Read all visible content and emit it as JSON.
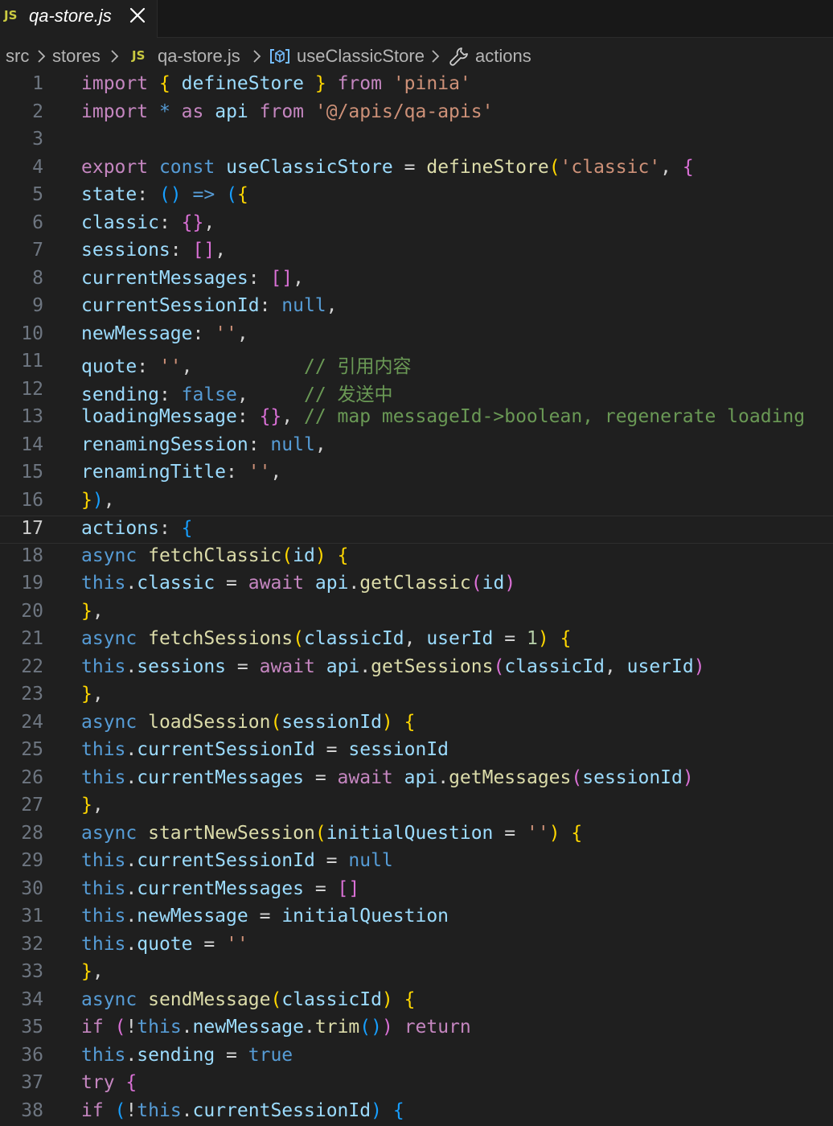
{
  "tab": {
    "badge": "JS",
    "filename": "qa-store.js"
  },
  "breadcrumb": {
    "items": [
      {
        "label": "src"
      },
      {
        "label": "stores"
      },
      {
        "label": "qa-store.js",
        "badge": "JS"
      },
      {
        "label": "useClassicStore"
      },
      {
        "label": "actions"
      }
    ]
  },
  "editor": {
    "current_line": 17,
    "lines": [
      {
        "n": "1",
        "tokens": [
          [
            "ctl",
            "import"
          ],
          [
            "pl",
            " "
          ],
          [
            "b1",
            "{"
          ],
          [
            "pl",
            " "
          ],
          [
            "id",
            "defineStore"
          ],
          [
            "pl",
            " "
          ],
          [
            "b1",
            "}"
          ],
          [
            "pl",
            " "
          ],
          [
            "ctl",
            "from"
          ],
          [
            "pl",
            " "
          ],
          [
            "str",
            "'pinia'"
          ]
        ]
      },
      {
        "n": "2",
        "tokens": [
          [
            "ctl",
            "import"
          ],
          [
            "pl",
            " "
          ],
          [
            "kw",
            "*"
          ],
          [
            "pl",
            " "
          ],
          [
            "ctl",
            "as"
          ],
          [
            "pl",
            " "
          ],
          [
            "id",
            "api"
          ],
          [
            "pl",
            " "
          ],
          [
            "ctl",
            "from"
          ],
          [
            "pl",
            " "
          ],
          [
            "str",
            "'@/apis/qa-apis'"
          ]
        ]
      },
      {
        "n": "3",
        "tokens": []
      },
      {
        "n": "4",
        "tokens": [
          [
            "ctl",
            "export"
          ],
          [
            "pl",
            " "
          ],
          [
            "kw",
            "const"
          ],
          [
            "pl",
            " "
          ],
          [
            "id",
            "useClassicStore"
          ],
          [
            "pl",
            " "
          ],
          [
            "op",
            "="
          ],
          [
            "pl",
            " "
          ],
          [
            "fn",
            "defineStore"
          ],
          [
            "b1",
            "("
          ],
          [
            "str",
            "'classic'"
          ],
          [
            "pl",
            ", "
          ],
          [
            "b2",
            "{"
          ]
        ]
      },
      {
        "n": "5",
        "tokens": [
          [
            "id",
            "state"
          ],
          [
            "pl",
            ": "
          ],
          [
            "b3",
            "()"
          ],
          [
            "pl",
            " "
          ],
          [
            "kw",
            "=>"
          ],
          [
            "pl",
            " "
          ],
          [
            "b3",
            "("
          ],
          [
            "b1",
            "{"
          ]
        ]
      },
      {
        "n": "6",
        "tokens": [
          [
            "id",
            "classic"
          ],
          [
            "pl",
            ": "
          ],
          [
            "b2",
            "{}"
          ],
          [
            "pl",
            ","
          ]
        ]
      },
      {
        "n": "7",
        "tokens": [
          [
            "id",
            "sessions"
          ],
          [
            "pl",
            ": "
          ],
          [
            "b2",
            "[]"
          ],
          [
            "pl",
            ","
          ]
        ]
      },
      {
        "n": "8",
        "tokens": [
          [
            "id",
            "currentMessages"
          ],
          [
            "pl",
            ": "
          ],
          [
            "b2",
            "[]"
          ],
          [
            "pl",
            ","
          ]
        ]
      },
      {
        "n": "9",
        "tokens": [
          [
            "id",
            "currentSessionId"
          ],
          [
            "pl",
            ": "
          ],
          [
            "kw",
            "null"
          ],
          [
            "pl",
            ","
          ]
        ]
      },
      {
        "n": "10",
        "tokens": [
          [
            "id",
            "newMessage"
          ],
          [
            "pl",
            ": "
          ],
          [
            "str",
            "''"
          ],
          [
            "pl",
            ","
          ]
        ]
      },
      {
        "n": "11",
        "tokens": [
          [
            "id",
            "quote"
          ],
          [
            "pl",
            ": "
          ],
          [
            "str",
            "''"
          ],
          [
            "pl",
            ",          "
          ],
          [
            "cmt",
            "// "
          ],
          [
            "cmtcjk",
            "引用内容"
          ]
        ]
      },
      {
        "n": "12",
        "tokens": [
          [
            "id",
            "sending"
          ],
          [
            "pl",
            ": "
          ],
          [
            "kw",
            "false"
          ],
          [
            "pl",
            ",     "
          ],
          [
            "cmt",
            "// "
          ],
          [
            "cmtcjk",
            "发送中"
          ]
        ]
      },
      {
        "n": "13",
        "tokens": [
          [
            "id",
            "loadingMessage"
          ],
          [
            "pl",
            ": "
          ],
          [
            "b2",
            "{}"
          ],
          [
            "pl",
            ", "
          ],
          [
            "cmt",
            "// map messageId->boolean, regenerate loading"
          ]
        ]
      },
      {
        "n": "14",
        "tokens": [
          [
            "id",
            "renamingSession"
          ],
          [
            "pl",
            ": "
          ],
          [
            "kw",
            "null"
          ],
          [
            "pl",
            ","
          ]
        ]
      },
      {
        "n": "15",
        "tokens": [
          [
            "id",
            "renamingTitle"
          ],
          [
            "pl",
            ": "
          ],
          [
            "str",
            "''"
          ],
          [
            "pl",
            ","
          ]
        ]
      },
      {
        "n": "16",
        "tokens": [
          [
            "b1",
            "}"
          ],
          [
            "b3",
            ")"
          ],
          [
            "pl",
            ","
          ]
        ]
      },
      {
        "n": "17",
        "tokens": [
          [
            "id",
            "actions"
          ],
          [
            "pl",
            ": "
          ],
          [
            "b3",
            "{"
          ]
        ]
      },
      {
        "n": "18",
        "tokens": [
          [
            "kw",
            "async"
          ],
          [
            "pl",
            " "
          ],
          [
            "fn",
            "fetchClassic"
          ],
          [
            "b1",
            "("
          ],
          [
            "id",
            "id"
          ],
          [
            "b1",
            ")"
          ],
          [
            "pl",
            " "
          ],
          [
            "b1",
            "{"
          ]
        ]
      },
      {
        "n": "19",
        "tokens": [
          [
            "kw",
            "this"
          ],
          [
            "pl",
            "."
          ],
          [
            "id",
            "classic"
          ],
          [
            "pl",
            " "
          ],
          [
            "op",
            "="
          ],
          [
            "pl",
            " "
          ],
          [
            "ctl",
            "await"
          ],
          [
            "pl",
            " "
          ],
          [
            "id",
            "api"
          ],
          [
            "pl",
            "."
          ],
          [
            "fn",
            "getClassic"
          ],
          [
            "b2",
            "("
          ],
          [
            "id",
            "id"
          ],
          [
            "b2",
            ")"
          ]
        ]
      },
      {
        "n": "20",
        "tokens": [
          [
            "b1",
            "}"
          ],
          [
            "pl",
            ","
          ]
        ]
      },
      {
        "n": "21",
        "tokens": [
          [
            "kw",
            "async"
          ],
          [
            "pl",
            " "
          ],
          [
            "fn",
            "fetchSessions"
          ],
          [
            "b1",
            "("
          ],
          [
            "id",
            "classicId"
          ],
          [
            "pl",
            ", "
          ],
          [
            "id",
            "userId"
          ],
          [
            "pl",
            " "
          ],
          [
            "op",
            "="
          ],
          [
            "pl",
            " "
          ],
          [
            "num",
            "1"
          ],
          [
            "b1",
            ")"
          ],
          [
            "pl",
            " "
          ],
          [
            "b1",
            "{"
          ]
        ]
      },
      {
        "n": "22",
        "tokens": [
          [
            "kw",
            "this"
          ],
          [
            "pl",
            "."
          ],
          [
            "id",
            "sessions"
          ],
          [
            "pl",
            " "
          ],
          [
            "op",
            "="
          ],
          [
            "pl",
            " "
          ],
          [
            "ctl",
            "await"
          ],
          [
            "pl",
            " "
          ],
          [
            "id",
            "api"
          ],
          [
            "pl",
            "."
          ],
          [
            "fn",
            "getSessions"
          ],
          [
            "b2",
            "("
          ],
          [
            "id",
            "classicId"
          ],
          [
            "pl",
            ", "
          ],
          [
            "id",
            "userId"
          ],
          [
            "b2",
            ")"
          ]
        ]
      },
      {
        "n": "23",
        "tokens": [
          [
            "b1",
            "}"
          ],
          [
            "pl",
            ","
          ]
        ]
      },
      {
        "n": "24",
        "tokens": [
          [
            "kw",
            "async"
          ],
          [
            "pl",
            " "
          ],
          [
            "fn",
            "loadSession"
          ],
          [
            "b1",
            "("
          ],
          [
            "id",
            "sessionId"
          ],
          [
            "b1",
            ")"
          ],
          [
            "pl",
            " "
          ],
          [
            "b1",
            "{"
          ]
        ]
      },
      {
        "n": "25",
        "tokens": [
          [
            "kw",
            "this"
          ],
          [
            "pl",
            "."
          ],
          [
            "id",
            "currentSessionId"
          ],
          [
            "pl",
            " "
          ],
          [
            "op",
            "="
          ],
          [
            "pl",
            " "
          ],
          [
            "id",
            "sessionId"
          ]
        ]
      },
      {
        "n": "26",
        "tokens": [
          [
            "kw",
            "this"
          ],
          [
            "pl",
            "."
          ],
          [
            "id",
            "currentMessages"
          ],
          [
            "pl",
            " "
          ],
          [
            "op",
            "="
          ],
          [
            "pl",
            " "
          ],
          [
            "ctl",
            "await"
          ],
          [
            "pl",
            " "
          ],
          [
            "id",
            "api"
          ],
          [
            "pl",
            "."
          ],
          [
            "fn",
            "getMessages"
          ],
          [
            "b2",
            "("
          ],
          [
            "id",
            "sessionId"
          ],
          [
            "b2",
            ")"
          ]
        ]
      },
      {
        "n": "27",
        "tokens": [
          [
            "b1",
            "}"
          ],
          [
            "pl",
            ","
          ]
        ]
      },
      {
        "n": "28",
        "tokens": [
          [
            "kw",
            "async"
          ],
          [
            "pl",
            " "
          ],
          [
            "fn",
            "startNewSession"
          ],
          [
            "b1",
            "("
          ],
          [
            "id",
            "initialQuestion"
          ],
          [
            "pl",
            " "
          ],
          [
            "op",
            "="
          ],
          [
            "pl",
            " "
          ],
          [
            "str",
            "''"
          ],
          [
            "b1",
            ")"
          ],
          [
            "pl",
            " "
          ],
          [
            "b1",
            "{"
          ]
        ]
      },
      {
        "n": "29",
        "tokens": [
          [
            "kw",
            "this"
          ],
          [
            "pl",
            "."
          ],
          [
            "id",
            "currentSessionId"
          ],
          [
            "pl",
            " "
          ],
          [
            "op",
            "="
          ],
          [
            "pl",
            " "
          ],
          [
            "kw",
            "null"
          ]
        ]
      },
      {
        "n": "30",
        "tokens": [
          [
            "kw",
            "this"
          ],
          [
            "pl",
            "."
          ],
          [
            "id",
            "currentMessages"
          ],
          [
            "pl",
            " "
          ],
          [
            "op",
            "="
          ],
          [
            "pl",
            " "
          ],
          [
            "b2",
            "[]"
          ]
        ]
      },
      {
        "n": "31",
        "tokens": [
          [
            "kw",
            "this"
          ],
          [
            "pl",
            "."
          ],
          [
            "id",
            "newMessage"
          ],
          [
            "pl",
            " "
          ],
          [
            "op",
            "="
          ],
          [
            "pl",
            " "
          ],
          [
            "id",
            "initialQuestion"
          ]
        ]
      },
      {
        "n": "32",
        "tokens": [
          [
            "kw",
            "this"
          ],
          [
            "pl",
            "."
          ],
          [
            "id",
            "quote"
          ],
          [
            "pl",
            " "
          ],
          [
            "op",
            "="
          ],
          [
            "pl",
            " "
          ],
          [
            "str",
            "''"
          ]
        ]
      },
      {
        "n": "33",
        "tokens": [
          [
            "b1",
            "}"
          ],
          [
            "pl",
            ","
          ]
        ]
      },
      {
        "n": "34",
        "tokens": [
          [
            "kw",
            "async"
          ],
          [
            "pl",
            " "
          ],
          [
            "fn",
            "sendMessage"
          ],
          [
            "b1",
            "("
          ],
          [
            "id",
            "classicId"
          ],
          [
            "b1",
            ")"
          ],
          [
            "pl",
            " "
          ],
          [
            "b1",
            "{"
          ]
        ]
      },
      {
        "n": "35",
        "tokens": [
          [
            "ctl",
            "if"
          ],
          [
            "pl",
            " "
          ],
          [
            "b2",
            "("
          ],
          [
            "op",
            "!"
          ],
          [
            "kw",
            "this"
          ],
          [
            "pl",
            "."
          ],
          [
            "id",
            "newMessage"
          ],
          [
            "pl",
            "."
          ],
          [
            "fn",
            "trim"
          ],
          [
            "b3",
            "()"
          ],
          [
            "b2",
            ")"
          ],
          [
            "pl",
            " "
          ],
          [
            "ctl",
            "return"
          ]
        ]
      },
      {
        "n": "36",
        "tokens": [
          [
            "kw",
            "this"
          ],
          [
            "pl",
            "."
          ],
          [
            "id",
            "sending"
          ],
          [
            "pl",
            " "
          ],
          [
            "op",
            "="
          ],
          [
            "pl",
            " "
          ],
          [
            "kw",
            "true"
          ]
        ]
      },
      {
        "n": "37",
        "tokens": [
          [
            "ctl",
            "try"
          ],
          [
            "pl",
            " "
          ],
          [
            "b2",
            "{"
          ]
        ]
      },
      {
        "n": "38",
        "tokens": [
          [
            "ctl",
            "if"
          ],
          [
            "pl",
            " "
          ],
          [
            "b3",
            "("
          ],
          [
            "op",
            "!"
          ],
          [
            "kw",
            "this"
          ],
          [
            "pl",
            "."
          ],
          [
            "id",
            "currentSessionId"
          ],
          [
            "b3",
            ")"
          ],
          [
            "pl",
            " "
          ],
          [
            "b3",
            "{"
          ]
        ]
      }
    ]
  }
}
